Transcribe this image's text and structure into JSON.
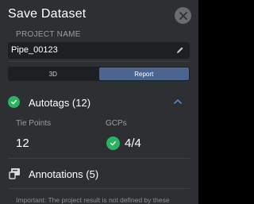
{
  "dialog": {
    "title": "Save Dataset",
    "close_icon": "close-icon"
  },
  "project": {
    "label": "PROJECT NAME",
    "value": "Pipe_00123",
    "edit_icon": "pencil-icon"
  },
  "view_toggle": {
    "options": [
      "3D",
      "Report"
    ],
    "selected": "Report"
  },
  "autotags": {
    "title": "Autotags (12)",
    "status_icon": "check-circle-icon",
    "expanded": true,
    "tie_points_label": "Tie Points",
    "tie_points_value": "12",
    "gcps_label": "GCPs",
    "gcps_value": "4/4"
  },
  "annotations": {
    "title": "Annotations (5)",
    "icon": "annotation-icon"
  },
  "note": {
    "text": "Important: The project result is not defined by these"
  },
  "colors": {
    "background": "#2d2f33",
    "input_bg": "#1e1f22",
    "accent_active": "#4a6690",
    "success": "#28b463",
    "chevron": "#4b8bd6"
  }
}
